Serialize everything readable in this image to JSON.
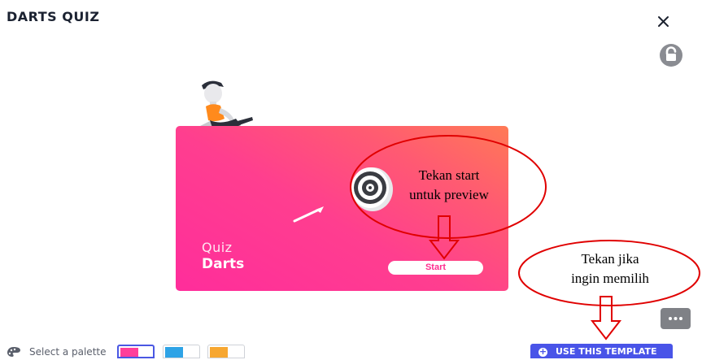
{
  "header": {
    "title": "DARTS QUIZ"
  },
  "icons": {
    "close": "close-icon",
    "round_button": "unlock-icon",
    "more": "more-horizontal-icon",
    "palette": "palette-icon",
    "plus": "plus-circle-icon",
    "dartboard": "dartboard-icon",
    "dart": "dart-icon",
    "character": "sitting-person-illustration"
  },
  "card": {
    "line1": "Quiz",
    "line2": "Darts",
    "start_label": "Start",
    "gradient_colors": [
      "#ff2d9b",
      "#ff5a72",
      "#ff7a55"
    ]
  },
  "annotations": {
    "preview": {
      "line1": "Tekan start",
      "line2": "untuk preview"
    },
    "select": {
      "line1": "Tekan jika",
      "line2": "ingin memilih"
    },
    "color": "#e00000"
  },
  "more_button": {
    "label": "···"
  },
  "palette": {
    "label": "Select a palette",
    "swatches": [
      {
        "color": "#ff3f9a",
        "selected": true
      },
      {
        "color": "#2ea3e6",
        "selected": false
      },
      {
        "color": "#f7a731",
        "selected": false
      }
    ]
  },
  "use_template_button": {
    "label": "USE THIS TEMPLATE"
  },
  "accent": "#4954e8"
}
